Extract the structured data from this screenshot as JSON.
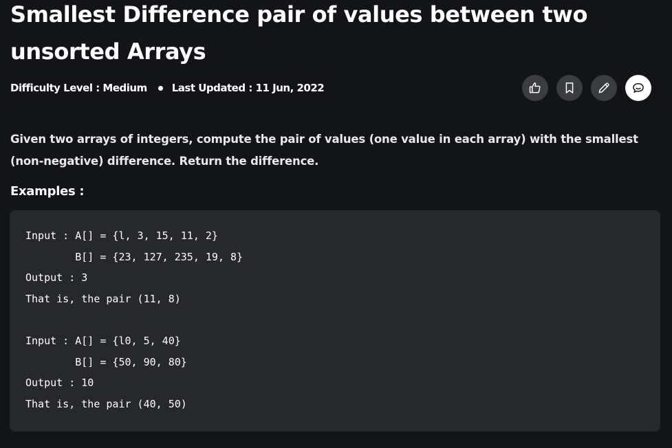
{
  "article": {
    "title": "Smallest Difference pair of values between two unsorted Arrays",
    "difficulty": "Difficulty Level : Medium",
    "last_updated": "Last Updated : 11 Jun, 2022",
    "description": "Given two arrays of integers, compute the pair of values (one value in each array) with the smallest (non-negative) difference. Return the difference.",
    "examples_label": "Examples :"
  },
  "actions": {
    "icons": [
      "thumbs-up-icon",
      "bookmark-icon",
      "pencil-icon",
      "chat-icon"
    ]
  },
  "code": {
    "lines": [
      "Input : A[] = {l, 3, 15, 11, 2}",
      "        B[] = {23, 127, 235, 19, 8}",
      "Output : 3",
      "That is, the pair (11, 8)",
      "",
      "Input : A[] = {l0, 5, 40}",
      "        B[] = {50, 90, 80}",
      "Output : 10",
      "That is, the pair (40, 50)"
    ]
  },
  "colors": {
    "background": "#131417",
    "code_background": "#27282c",
    "button_background": "#3a3c40",
    "text": "#ffffff"
  }
}
